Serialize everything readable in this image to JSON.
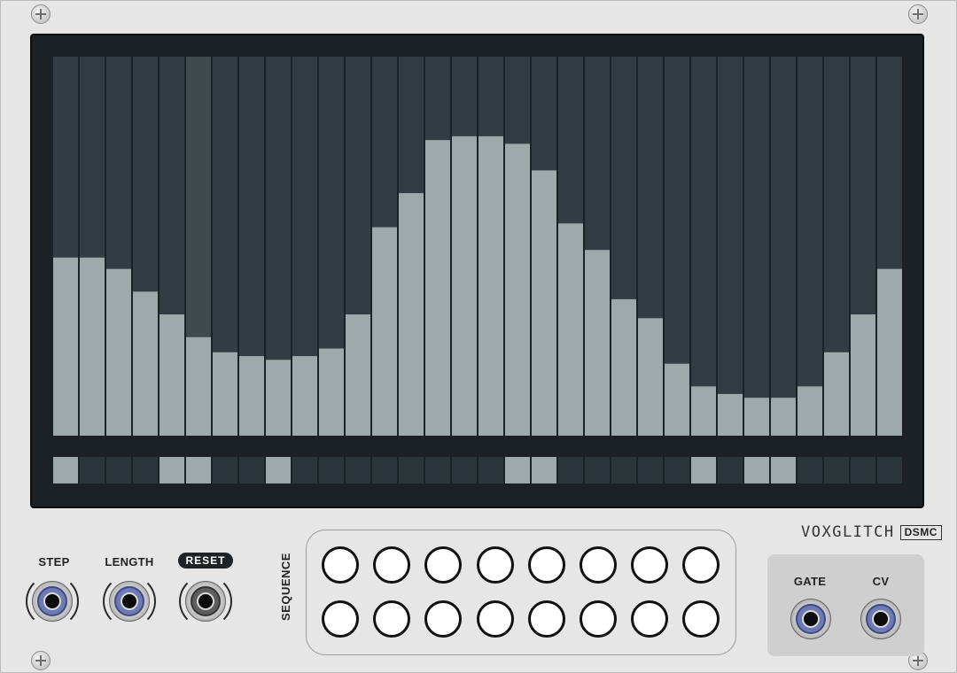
{
  "module": {
    "brand_name": "VOXGLITCH",
    "brand_tag": "DSMC"
  },
  "sequencer_display": {
    "step_count": 32,
    "values": [
      0.47,
      0.47,
      0.44,
      0.38,
      0.32,
      0.26,
      0.22,
      0.21,
      0.2,
      0.21,
      0.23,
      0.32,
      0.55,
      0.64,
      0.78,
      0.79,
      0.79,
      0.77,
      0.7,
      0.56,
      0.49,
      0.36,
      0.31,
      0.19,
      0.13,
      0.11,
      0.1,
      0.1,
      0.13,
      0.22,
      0.32,
      0.44
    ],
    "gates": [
      1,
      0,
      0,
      0,
      1,
      1,
      0,
      0,
      1,
      0,
      0,
      0,
      0,
      0,
      0,
      0,
      0,
      1,
      1,
      0,
      0,
      0,
      0,
      0,
      1,
      0,
      1,
      1,
      0,
      0,
      0,
      0
    ],
    "active_step": 5,
    "colors": {
      "bar": "#9ea9ab",
      "bar_bg": "#313d42",
      "bar_bg_active": "#3f4a4f",
      "gate_on": "#9ea9ab",
      "gate_off": "#2b363a",
      "screen": "#1b2124"
    }
  },
  "inputs": {
    "step_label": "STEP",
    "length_label": "LENGTH",
    "reset_label": "RESET"
  },
  "sequence": {
    "label": "SEQUENCE",
    "buttons_per_row": 8,
    "rows": 2
  },
  "outputs": {
    "gate_label": "GATE",
    "cv_label": "CV"
  },
  "jack_colors": {
    "blue": "#6d7ab5",
    "dark": "#5e5e5e"
  }
}
